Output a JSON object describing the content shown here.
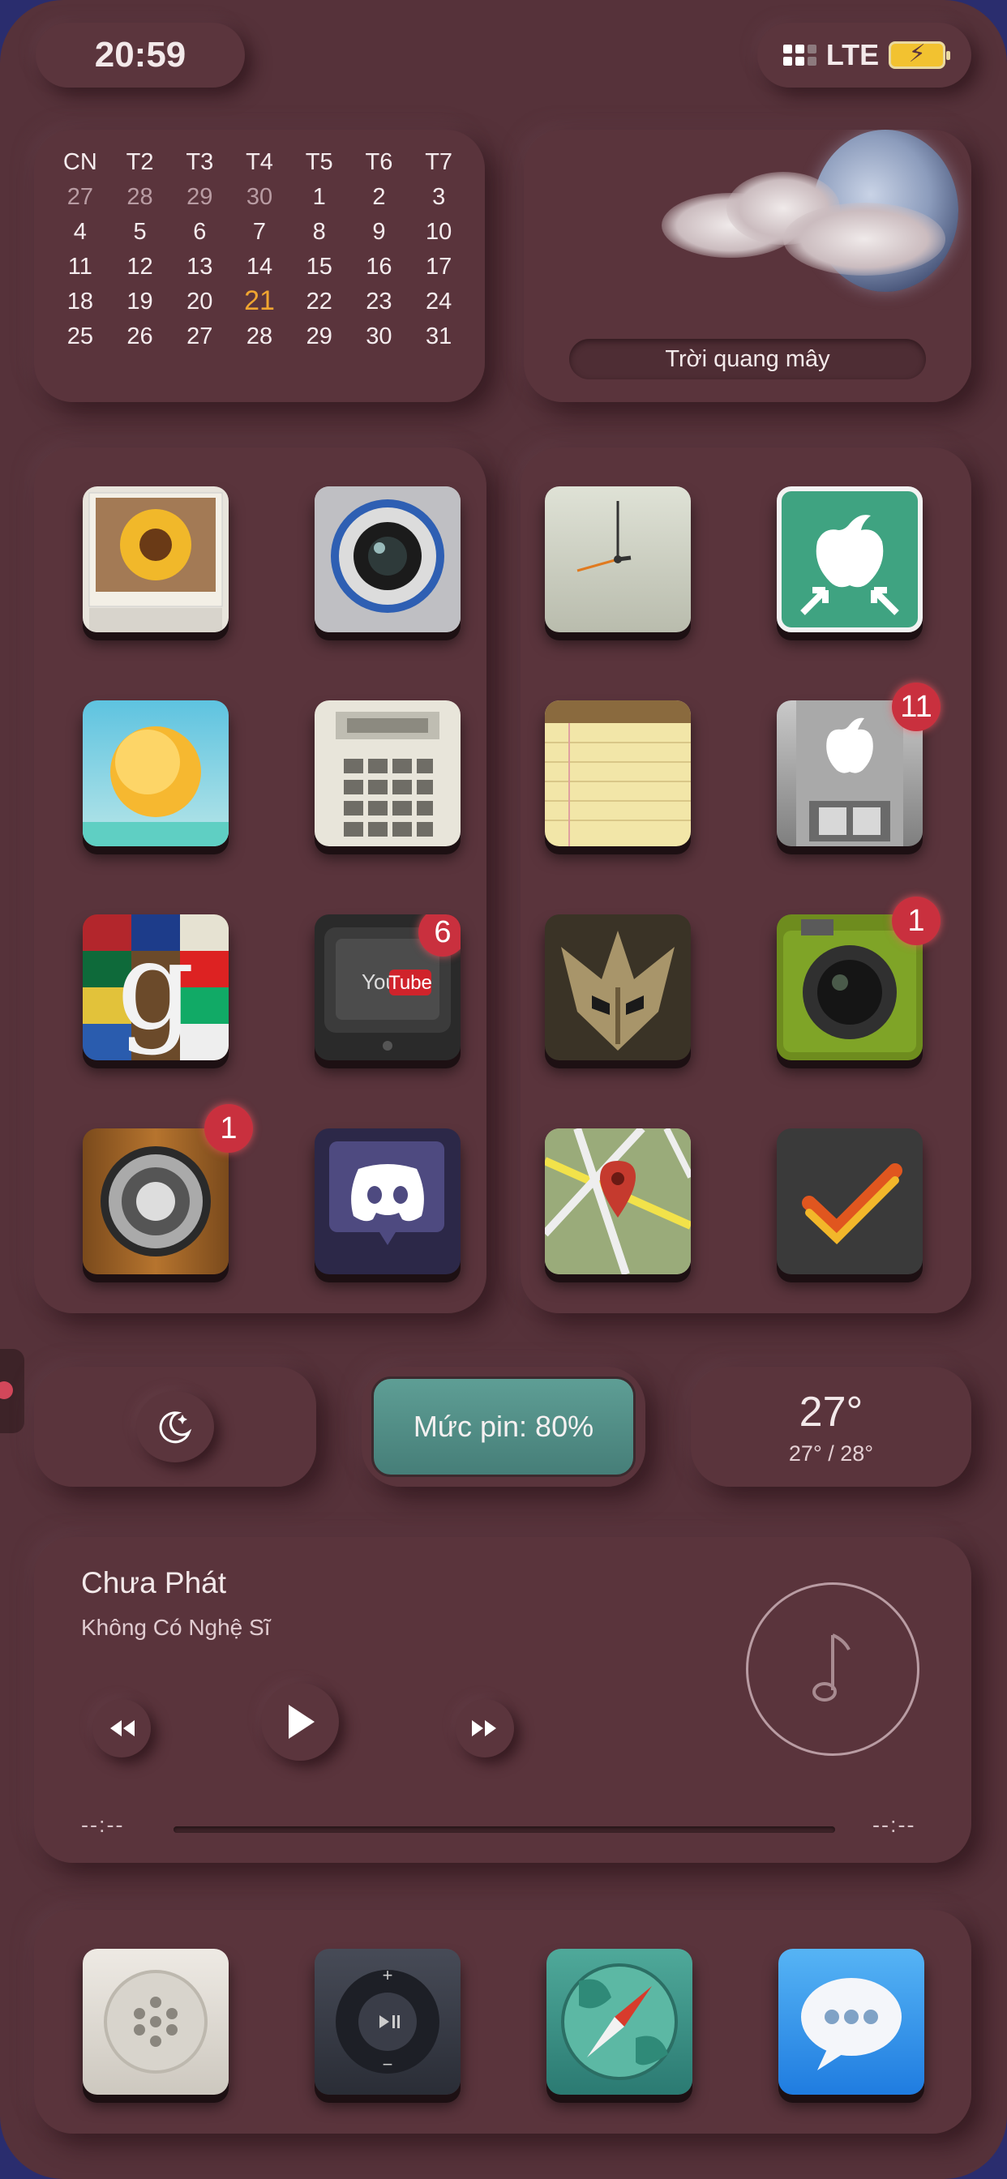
{
  "status_bar": {
    "time": "20:59",
    "network": "LTE",
    "battery_icon": "battery-charging-icon"
  },
  "calendar": {
    "weekdays": [
      "CN",
      "T2",
      "T3",
      "T4",
      "T5",
      "T6",
      "T7"
    ],
    "days": [
      [
        "27",
        "28",
        "29",
        "30",
        "1",
        "2",
        "3"
      ],
      [
        "4",
        "5",
        "6",
        "7",
        "8",
        "9",
        "10"
      ],
      [
        "11",
        "12",
        "13",
        "14",
        "15",
        "16",
        "17"
      ],
      [
        "18",
        "19",
        "20",
        "21",
        "22",
        "23",
        "24"
      ],
      [
        "25",
        "26",
        "27",
        "28",
        "29",
        "30",
        "31"
      ]
    ],
    "today": "21",
    "accent_color": "#f0a530"
  },
  "weather": {
    "condition": "Trời quang mây",
    "temperature": "27°",
    "range": "27° / 28°"
  },
  "apps_left": [
    {
      "icon": "photos-sunflower-icon",
      "badge": ""
    },
    {
      "icon": "camera-lens-icon",
      "badge": ""
    },
    {
      "icon": "weather-sun-icon",
      "badge": ""
    },
    {
      "icon": "calculator-icon",
      "badge": ""
    },
    {
      "icon": "google-flags-icon",
      "badge": ""
    },
    {
      "icon": "youtube-tv-icon",
      "badge": "6"
    },
    {
      "icon": "speaker-music-icon",
      "badge": "1"
    },
    {
      "icon": "discord-icon",
      "badge": ""
    }
  ],
  "apps_right": [
    {
      "icon": "clock-icon",
      "badge": ""
    },
    {
      "icon": "app-store-sign-icon",
      "badge": ""
    },
    {
      "icon": "notes-legal-pad-icon",
      "badge": ""
    },
    {
      "icon": "apple-store-icon",
      "badge": "11"
    },
    {
      "icon": "warrior-helmet-game-icon",
      "badge": ""
    },
    {
      "icon": "green-camera-icon",
      "badge": "1"
    },
    {
      "icon": "maps-pin-icon",
      "badge": ""
    },
    {
      "icon": "tasks-checkmark-icon",
      "badge": ""
    }
  ],
  "focus": {
    "icon": "moon-sleep-icon"
  },
  "battery_widget": {
    "label": "Mức pin: 80%",
    "level_percent": 80,
    "color": "#5e9e95"
  },
  "music": {
    "title": "Chưa Phát",
    "artist": "Không Có Nghệ Sĩ",
    "elapsed": "--:--",
    "remaining": "--:--",
    "progress": 0
  },
  "dock": [
    {
      "icon": "phone-icon"
    },
    {
      "icon": "ipod-shuffle-icon"
    },
    {
      "icon": "safari-compass-icon"
    },
    {
      "icon": "messages-icon"
    }
  ],
  "colors": {
    "background": "#56323a",
    "badge": "#c9303e"
  }
}
